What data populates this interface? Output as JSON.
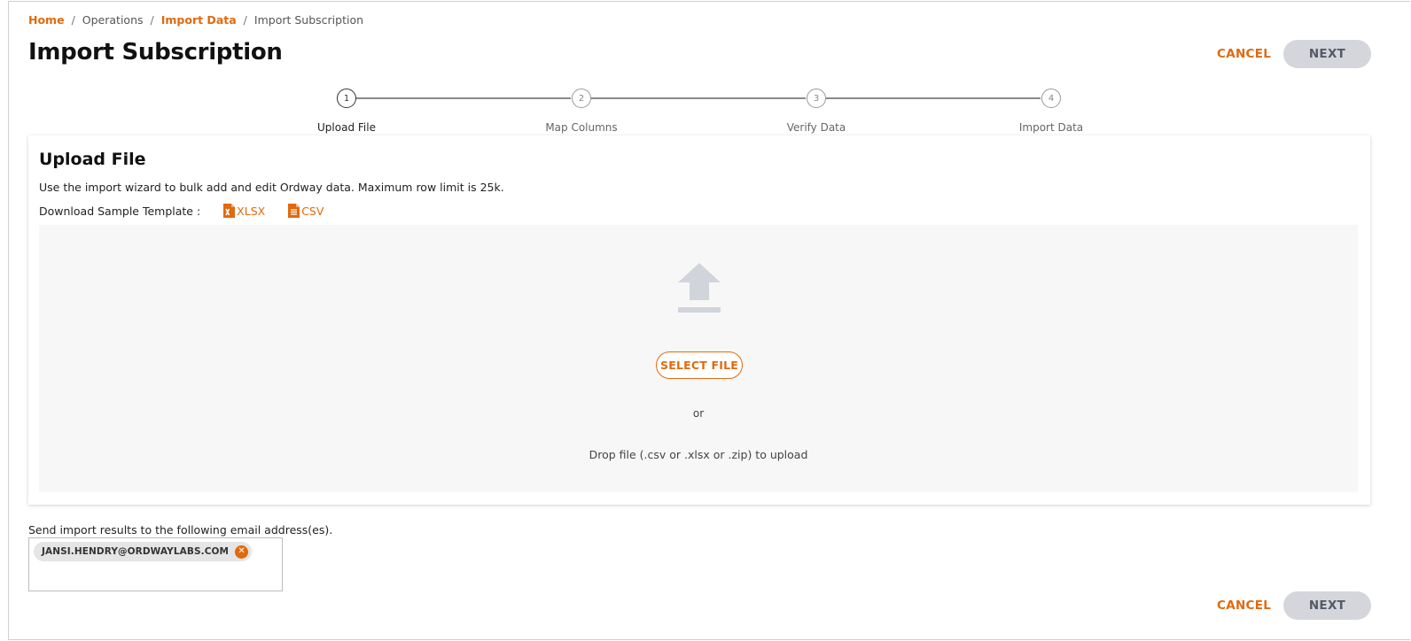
{
  "breadcrumb": [
    {
      "label": "Home",
      "link": true
    },
    {
      "label": "Operations",
      "link": false
    },
    {
      "label": "Import Data",
      "link": true
    },
    {
      "label": "Import Subscription",
      "link": false
    }
  ],
  "page": {
    "title": "Import Subscription"
  },
  "actions": {
    "cancel_label": "CANCEL",
    "next_label": "NEXT"
  },
  "stepper": {
    "steps": [
      {
        "number": "1",
        "label": "Upload File",
        "active": true
      },
      {
        "number": "2",
        "label": "Map Columns",
        "active": false
      },
      {
        "number": "3",
        "label": "Verify Data",
        "active": false
      },
      {
        "number": "4",
        "label": "Import Data",
        "active": false
      }
    ]
  },
  "upload": {
    "title": "Upload File",
    "description": "Use the import wizard to bulk add and edit Ordway data. Maximum row limit is 25k.",
    "template_label": "Download Sample Template :",
    "templates": [
      {
        "label": "XLSX",
        "icon": "excel-file-icon"
      },
      {
        "label": "CSV",
        "icon": "csv-file-icon"
      }
    ],
    "select_file_label": "SELECT FILE",
    "or_text": "or",
    "drop_text": "Drop file (.csv or .xlsx or .zip) to upload"
  },
  "email": {
    "label": "Send import results to the following email address(es).",
    "recipients": [
      "JANSI.HENDRY@ORDWAYLABS.COM"
    ]
  },
  "colors": {
    "accent": "#e06a0f",
    "next_button_bg": "#d5d6dc",
    "dropzone_bg": "#f7f7f7"
  }
}
